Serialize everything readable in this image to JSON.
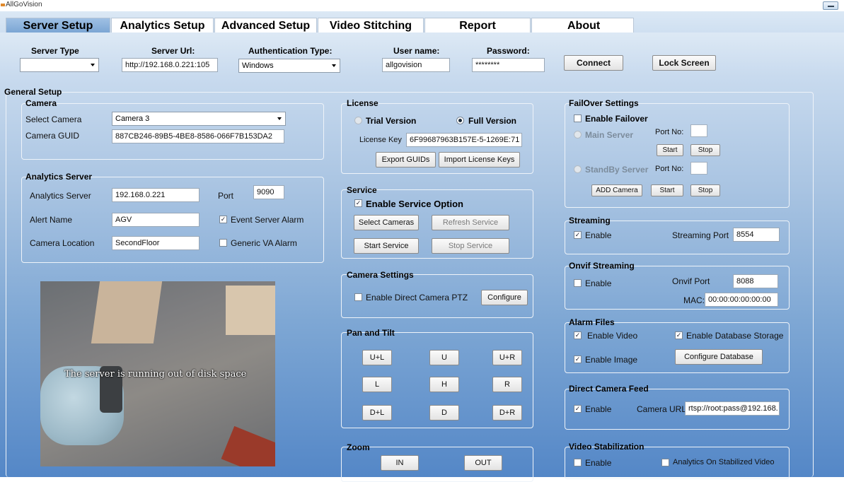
{
  "window": {
    "title": "AllGoVision"
  },
  "tabs": [
    {
      "label": "Server Setup",
      "active": true
    },
    {
      "label": "Analytics Setup"
    },
    {
      "label": "Advanced Setup"
    },
    {
      "label": "Video Stitching"
    },
    {
      "label": "Report"
    },
    {
      "label": "About"
    }
  ],
  "server": {
    "type_label": "Server Type",
    "type_value": "",
    "url_label": "Server Url:",
    "url_value": "http://192.168.0.221:105",
    "auth_label": "Authentication Type:",
    "auth_value": "Windows",
    "user_label": "User name:",
    "user_value": "allgovision",
    "password_label": "Password:",
    "password_value": "********",
    "connect": "Connect",
    "lock": "Lock Screen"
  },
  "general_setup": "General Setup",
  "camera": {
    "title": "Camera",
    "select_label": "Select Camera",
    "select_value": "Camera 3",
    "guid_label": "Camera GUID",
    "guid_value": "887CB246-89B5-4BE8-8586-066F7B153DA2"
  },
  "analytics_server": {
    "title": "Analytics Server",
    "server_label": "Analytics Server",
    "server_value": "192.168.0.221",
    "port_label": "Port",
    "port_value": "9090",
    "alert_label": "Alert Name",
    "alert_value": "AGV",
    "event_alarm": "Event Server Alarm",
    "event_alarm_checked": true,
    "location_label": "Camera Location",
    "location_value": "SecondFloor",
    "generic_alarm": "Generic VA Alarm",
    "generic_alarm_checked": false
  },
  "video": {
    "overlay": "The server is running out of disk space"
  },
  "license": {
    "title": "License",
    "trial": "Trial Version",
    "full": "Full Version",
    "key_label": "License Key",
    "key_value": "6F99687963B157E-5-1269E:71",
    "export": "Export GUIDs",
    "import": "Import License Keys"
  },
  "service": {
    "title": "Service",
    "enable": "Enable Service Option",
    "select_cameras": "Select Cameras",
    "refresh": "Refresh Service",
    "start": "Start Service",
    "stop": "Stop Service"
  },
  "camera_settings": {
    "title": "Camera Settings",
    "ptz": "Enable Direct Camera PTZ",
    "configure": "Configure"
  },
  "pan_tilt": {
    "title": "Pan and Tilt",
    "buttons": [
      "U+L",
      "U",
      "U+R",
      "L",
      "H",
      "R",
      "D+L",
      "D",
      "D+R"
    ]
  },
  "zoom": {
    "title": "Zoom",
    "in": "IN",
    "out": "OUT"
  },
  "failover": {
    "title": "FailOver Settings",
    "enable": "Enable Failover",
    "main": "Main Server",
    "port_label": "Port No:",
    "start": "Start",
    "stop": "Stop",
    "standby": "StandBy Server",
    "add_camera": "ADD Camera"
  },
  "streaming": {
    "title": "Streaming",
    "enable": "Enable",
    "port_label": "Streaming Port",
    "port_value": "8554"
  },
  "onvif": {
    "title": "Onvif Streaming",
    "enable": "Enable",
    "port_label": "Onvif Port",
    "port_value": "8088",
    "mac_label": "MAC:",
    "mac_value": "00:00:00:00:00:00"
  },
  "alarm_files": {
    "title": "Alarm Files",
    "video": "Enable Video",
    "db_storage": "Enable Database Storage",
    "image": "Enable Image",
    "configure_db": "Configure Database"
  },
  "direct_feed": {
    "title": "Direct Camera Feed",
    "enable": "Enable",
    "url_label": "Camera URL",
    "url_value": "rtsp://root:pass@192.168."
  },
  "stabilization": {
    "title": "Video Stabilization",
    "enable": "Enable",
    "analytics": "Analytics On Stabilized Video"
  }
}
